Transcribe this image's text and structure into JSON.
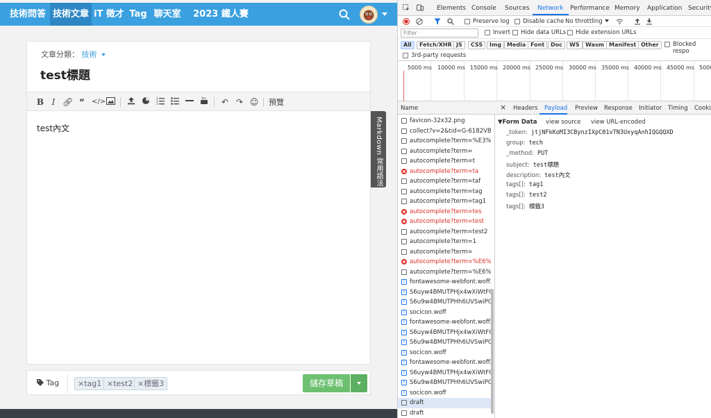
{
  "app": {
    "nav": [
      "技術問答",
      "技術文章",
      "iT 徵才",
      "Tag",
      "聊天室",
      "2023 鐵人賽"
    ],
    "active_nav": "技術文章",
    "category_label": "文章分類：",
    "category_value": "技術",
    "title": "test標題",
    "content": "test內文",
    "preview_label": "預覽",
    "markdown_tab": "Markdown 常用語法",
    "tag_label": "Tag",
    "tags": [
      "×tag1",
      "×test2",
      "×標籤3"
    ],
    "save_label": "儲存草稿",
    "toolbar_icons": [
      "bold-icon",
      "italic-icon",
      "link-icon",
      "quote-icon",
      "code-icon",
      "image-icon",
      "upload-icon",
      "chart-icon",
      "ordered-list-icon",
      "unordered-list-icon",
      "horizontal-rule-icon",
      "youtube-icon",
      "undo-icon",
      "redo-icon",
      "emoji-icon"
    ]
  },
  "devtools": {
    "tabs": [
      "Elements",
      "Console",
      "Sources",
      "Network",
      "Performance",
      "Memory",
      "Application",
      "Security"
    ],
    "active_tab": "Network",
    "row2": {
      "preserve_log": "Preserve log",
      "disable_cache": "Disable cache",
      "throttling": "No throttling"
    },
    "filter_placeholder": "Filter",
    "row3": {
      "invert": "Invert",
      "hide_data_urls": "Hide data URLs",
      "hide_ext_urls": "Hide extension URLs"
    },
    "filter_types": [
      "All",
      "Fetch/XHR",
      "JS",
      "CSS",
      "Img",
      "Media",
      "Font",
      "Doc",
      "WS",
      "Wasm",
      "Manifest",
      "Other"
    ],
    "blocked": "Blocked respo",
    "third_party": "3rd-party requests",
    "timeline_labels": [
      "5000 ms",
      "10000 ms",
      "15000 ms",
      "20000 ms",
      "25000 ms",
      "30000 ms",
      "35000 ms",
      "40000 ms",
      "45000 ms",
      "5000"
    ],
    "name_header": "Name",
    "requests": [
      {
        "name": "favicon-32x32.png",
        "kind": "doc"
      },
      {
        "name": "collect?v=2&tid=G-6182VBH...",
        "kind": "doc"
      },
      {
        "name": "autocomplete?term=%E3%8...",
        "kind": "doc"
      },
      {
        "name": "autocomplete?term=",
        "kind": "doc"
      },
      {
        "name": "autocomplete?term=t",
        "kind": "doc"
      },
      {
        "name": "autocomplete?term=ta",
        "kind": "err"
      },
      {
        "name": "autocomplete?term=taf",
        "kind": "doc"
      },
      {
        "name": "autocomplete?term=tag",
        "kind": "doc"
      },
      {
        "name": "autocomplete?term=tag1",
        "kind": "doc"
      },
      {
        "name": "autocomplete?term=tes",
        "kind": "err"
      },
      {
        "name": "autocomplete?term=test",
        "kind": "err"
      },
      {
        "name": "autocomplete?term=test2",
        "kind": "doc"
      },
      {
        "name": "autocomplete?term=1",
        "kind": "doc"
      },
      {
        "name": "autocomplete?term=",
        "kind": "doc"
      },
      {
        "name": "autocomplete?term=%E6%A...",
        "kind": "err"
      },
      {
        "name": "autocomplete?term=%E6%A...",
        "kind": "doc"
      },
      {
        "name": "fontawesome-webfont.woff2...",
        "kind": "font"
      },
      {
        "name": "S6uyw4BMUTPHjx4wXiWtFC...",
        "kind": "font"
      },
      {
        "name": "S6u9w4BMUTPHh6UVSwiPG...",
        "kind": "font"
      },
      {
        "name": "socicon.woff",
        "kind": "font"
      },
      {
        "name": "fontawesome-webfont.woff2...",
        "kind": "font"
      },
      {
        "name": "S6uyw4BMUTPHjx4wXiWtFC...",
        "kind": "font"
      },
      {
        "name": "S6u9w4BMUTPHh6UVSwiPG...",
        "kind": "font"
      },
      {
        "name": "socicon.woff",
        "kind": "font"
      },
      {
        "name": "fontawesome-webfont.woff2...",
        "kind": "font"
      },
      {
        "name": "S6uyw4BMUTPHjx4wXiWtFC...",
        "kind": "font"
      },
      {
        "name": "S6u9w4BMUTPHh6UVSwiPG...",
        "kind": "font"
      },
      {
        "name": "socicon.woff",
        "kind": "font"
      },
      {
        "name": "draft",
        "kind": "doc",
        "selected": true
      },
      {
        "name": "draft",
        "kind": "doc"
      }
    ],
    "detail_tabs": [
      "Headers",
      "Payload",
      "Preview",
      "Response",
      "Initiator",
      "Timing",
      "Cookie"
    ],
    "active_detail_tab": "Payload",
    "form_data_title": "▼Form Data",
    "view_source": "view source",
    "view_url_encoded": "view URL-encoded",
    "form_data": [
      {
        "key": "_token:",
        "value": "jtjNFkKoMI3CBynzIXpC01vTN3UxyqAnhIQGQQXD"
      },
      {
        "key": "group:",
        "value": "tech"
      },
      {
        "key": "_method:",
        "value": "PUT"
      },
      {
        "key": "subject:",
        "value": "test標題"
      },
      {
        "key": "description:",
        "value": "test內文"
      },
      {
        "key": "tags[]:",
        "value": "tag1"
      },
      {
        "key": "tags[]:",
        "value": "test2"
      },
      {
        "key": "tags[]:",
        "value": "標籤3"
      }
    ]
  }
}
